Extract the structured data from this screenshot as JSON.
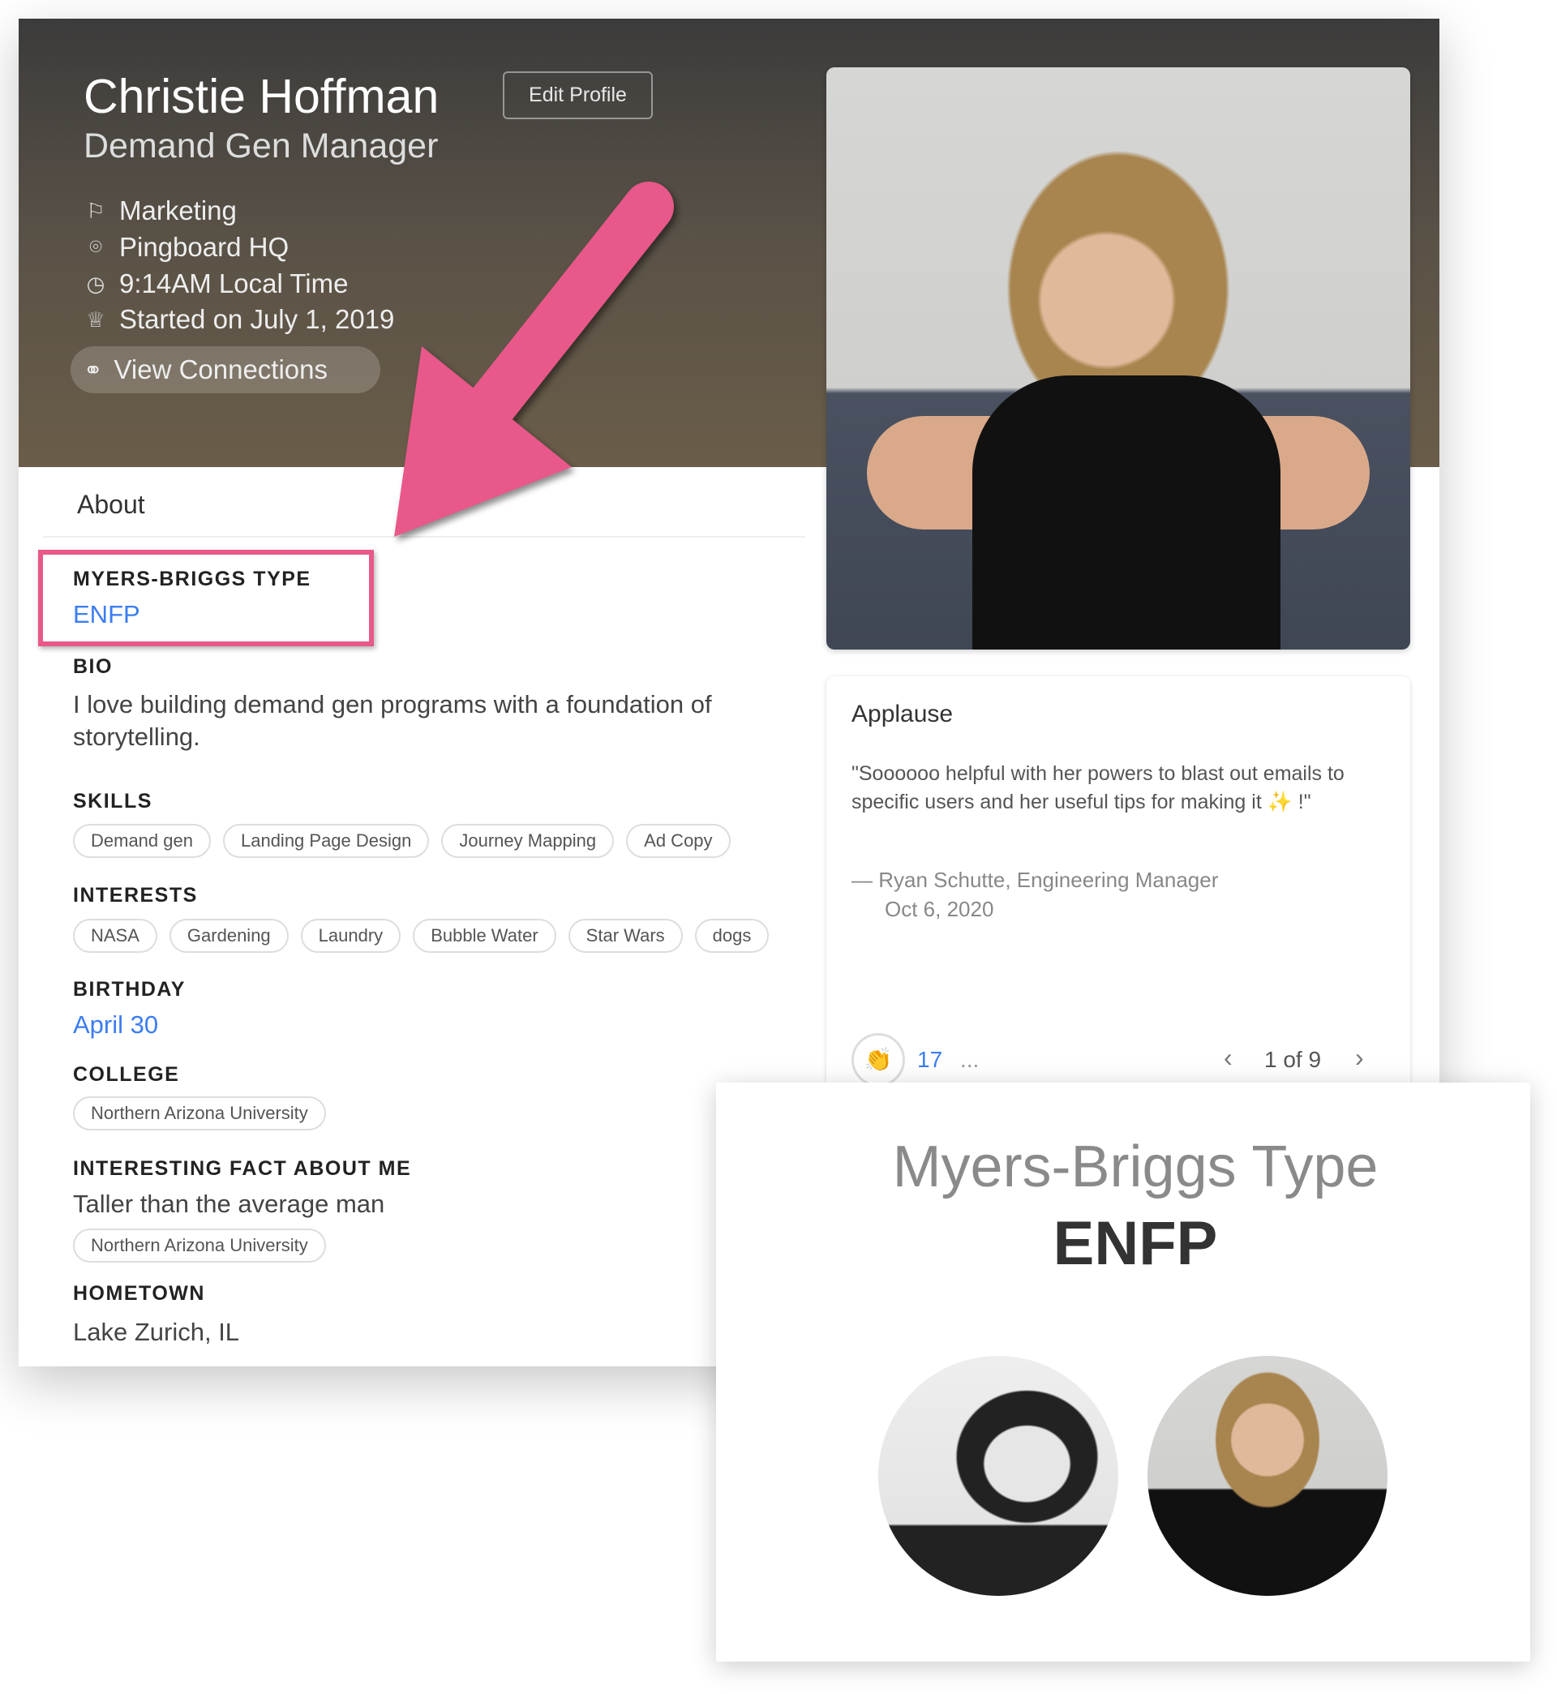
{
  "profile": {
    "name": "Christie Hoffman",
    "edit_label": "Edit Profile",
    "job_title": "Demand Gen Manager",
    "info": [
      {
        "icon": "flag-icon",
        "text": "Marketing"
      },
      {
        "icon": "location-pin-icon",
        "text": "Pingboard HQ"
      },
      {
        "icon": "clock-icon",
        "text": "9:14AM Local Time"
      },
      {
        "icon": "trophy-icon",
        "text": "Started on July 1, 2019"
      }
    ],
    "connections_label": "View Connections"
  },
  "about": {
    "tab_label": "About",
    "myers_briggs": {
      "label": "MYERS-BRIGGS TYPE",
      "value": "ENFP"
    },
    "bio": {
      "label": "BIO",
      "text": "I love building demand gen programs with a foundation of storytelling."
    },
    "skills": {
      "label": "SKILLS",
      "items": [
        "Demand gen",
        "Landing Page Design",
        "Journey Mapping",
        "Ad Copy"
      ]
    },
    "interests": {
      "label": "INTERESTS",
      "items": [
        "NASA",
        "Gardening",
        "Laundry",
        "Bubble Water",
        "Star Wars",
        "dogs"
      ]
    },
    "birthday": {
      "label": "BIRTHDAY",
      "value": "April 30"
    },
    "college": {
      "label": "COLLEGE",
      "items": [
        "Northern Arizona University"
      ]
    },
    "fact": {
      "label": "INTERESTING FACT ABOUT ME",
      "text": "Taller than the average man",
      "items": [
        "Northern Arizona University"
      ]
    },
    "hometown": {
      "label": "HOMETOWN",
      "value": "Lake Zurich, IL"
    }
  },
  "applause": {
    "title": "Applause",
    "quote": "\"Soooooo helpful with her powers to blast out emails to specific users and her useful tips for making it ✨ !\"",
    "author": "— Ryan Schutte, Engineering Manager",
    "date": "Oct 6, 2020",
    "reaction_count": "17",
    "more": "...",
    "pager": "1 of 9",
    "prev": "‹",
    "next": "›"
  },
  "overlay": {
    "title": "Myers-Briggs Type",
    "value": "ENFP"
  },
  "colors": {
    "accent_pink": "#e8588a",
    "link_blue": "#3b7df0"
  }
}
